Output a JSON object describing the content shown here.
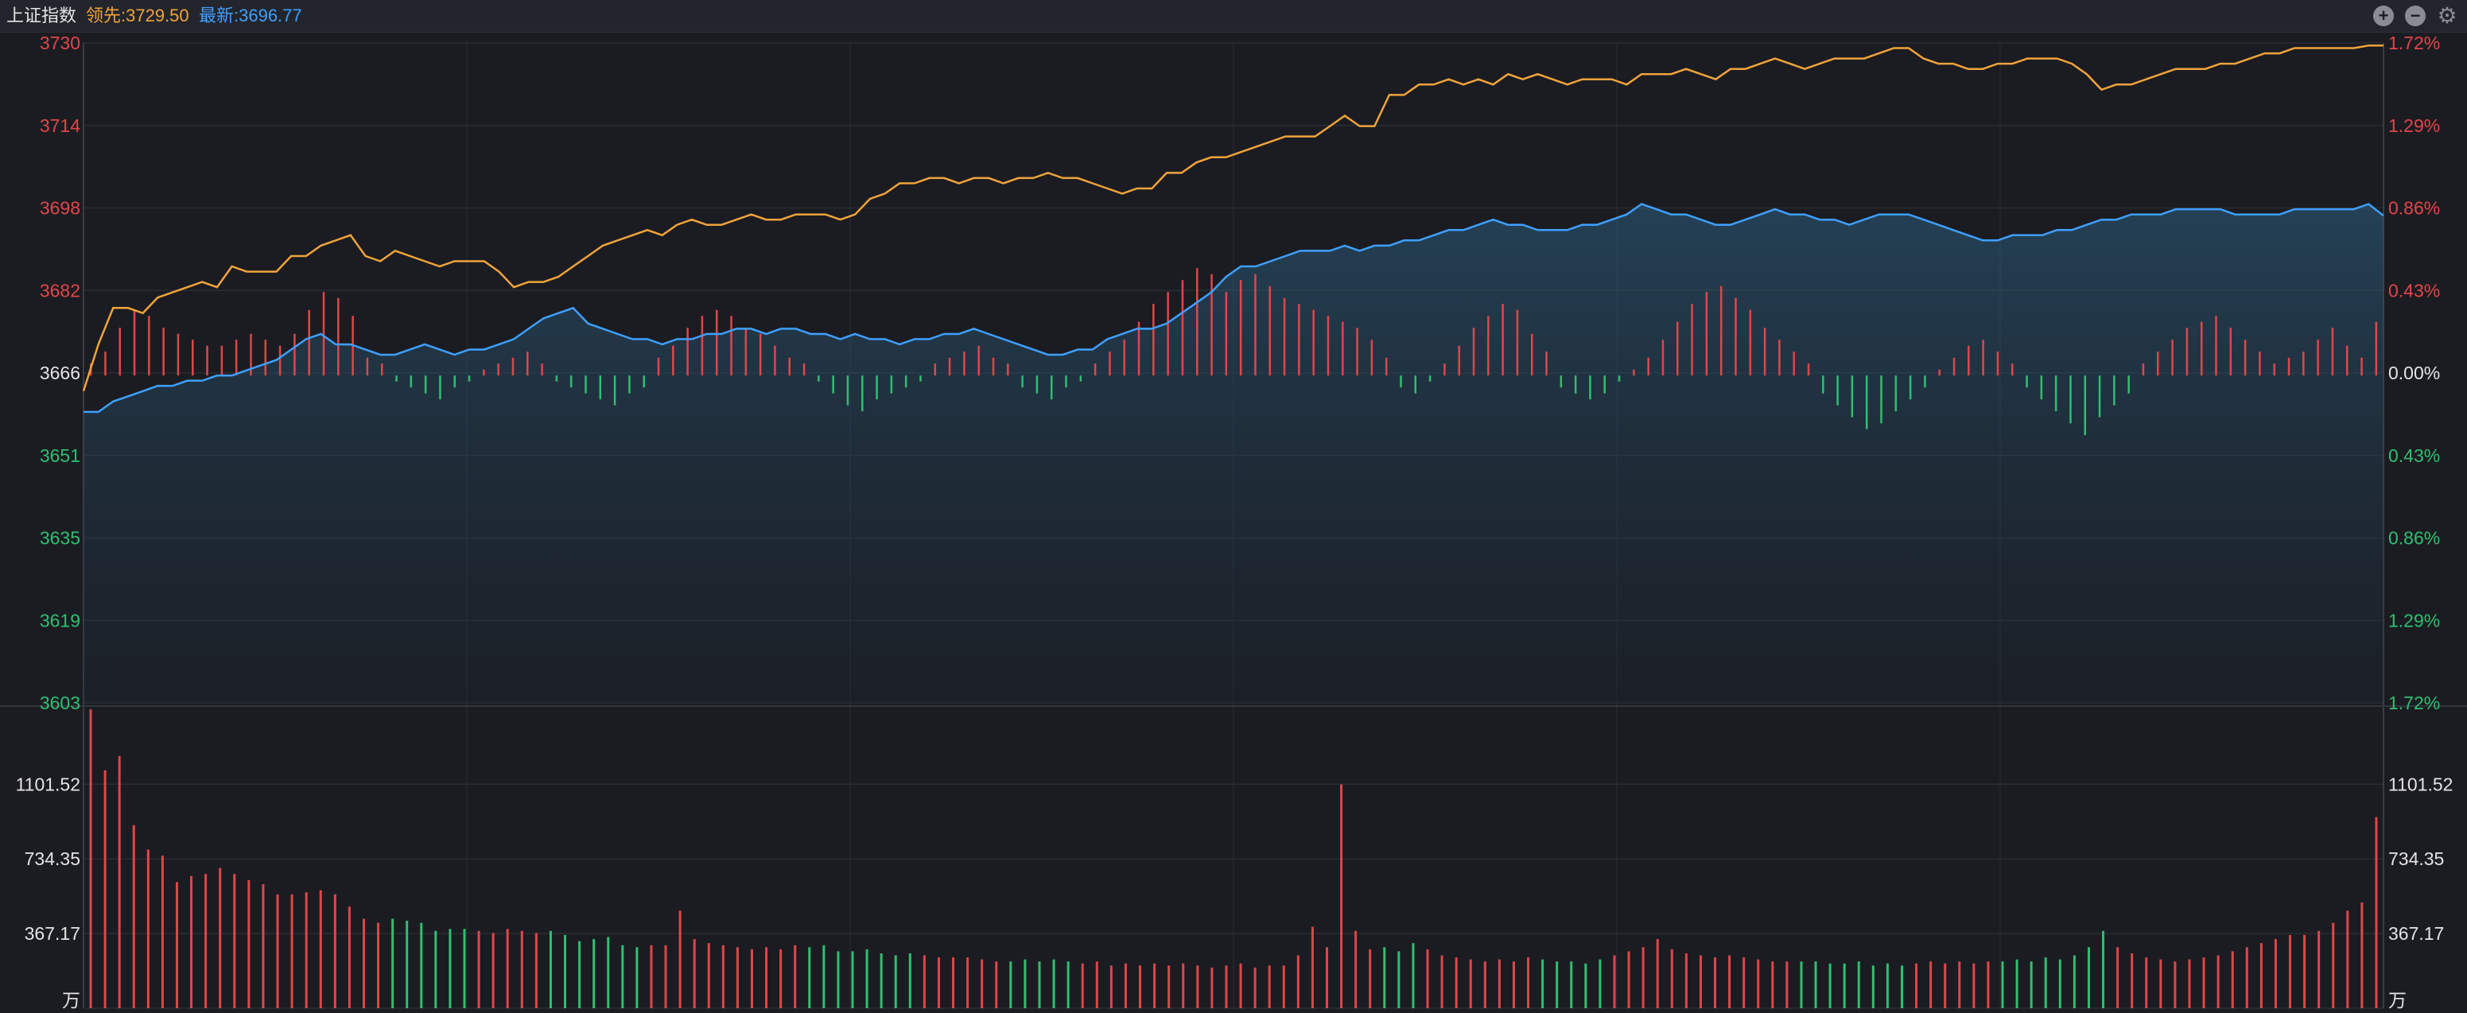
{
  "header": {
    "title": "上证指数",
    "leading": "领先:3729.50",
    "latest": "最新:3696.77"
  },
  "colors": {
    "background": "#1b1c21",
    "leading_line": "#f0a33b",
    "latest_line": "#3ea0ff",
    "up": "#e0464a",
    "down": "#2fbf71",
    "grid": "#2a2c33"
  },
  "icons": [
    "zoom-in-icon",
    "zoom-out-icon",
    "gear-icon"
  ],
  "chart_data": {
    "type": "line",
    "title": "上证指数",
    "price_axis": {
      "labels": [
        "3730",
        "3714",
        "3698",
        "3682",
        "3666",
        "3651",
        "3635",
        "3619",
        "3603"
      ],
      "range": [
        3603,
        3730
      ],
      "base": 3666
    },
    "pct_axis": {
      "labels": [
        "1.72%",
        "1.29%",
        "0.86%",
        "0.43%",
        "0.00%",
        "0.43%",
        "0.86%",
        "1.29%",
        "1.72%"
      ]
    },
    "volume_axis": {
      "labels": [
        "1101.52",
        "734.35",
        "367.17",
        "万"
      ],
      "range": [
        0,
        1470
      ]
    },
    "series": [
      {
        "name": "领先",
        "values": [
          3663,
          3672,
          3679,
          3679,
          3678,
          3681,
          3682,
          3683,
          3684,
          3683,
          3687,
          3686,
          3686,
          3686,
          3689,
          3689,
          3691,
          3692,
          3693,
          3689,
          3688,
          3690,
          3689,
          3688,
          3687,
          3688,
          3688,
          3688,
          3686,
          3683,
          3684,
          3684,
          3685,
          3687,
          3689,
          3691,
          3692,
          3693,
          3694,
          3693,
          3695,
          3696,
          3695,
          3695,
          3696,
          3697,
          3696,
          3696,
          3697,
          3697,
          3697,
          3696,
          3697,
          3700,
          3701,
          3703,
          3703,
          3704,
          3704,
          3703,
          3704,
          3704,
          3703,
          3704,
          3704,
          3705,
          3704,
          3704,
          3703,
          3702,
          3701,
          3702,
          3702,
          3705,
          3705,
          3707,
          3708,
          3708,
          3709,
          3710,
          3711,
          3712,
          3712,
          3712,
          3714,
          3716,
          3714,
          3714,
          3720,
          3720,
          3722,
          3722,
          3723,
          3722,
          3723,
          3722,
          3724,
          3723,
          3724,
          3723,
          3722,
          3723,
          3723,
          3723,
          3722,
          3724,
          3724,
          3724,
          3725,
          3724,
          3723,
          3725,
          3725,
          3726,
          3727,
          3726,
          3725,
          3726,
          3727,
          3727,
          3727,
          3728,
          3729,
          3729,
          3727,
          3726,
          3726,
          3725,
          3725,
          3726,
          3726,
          3727,
          3727,
          3727,
          3726,
          3724,
          3721,
          3722,
          3722,
          3723,
          3724,
          3725,
          3725,
          3725,
          3726,
          3726,
          3727,
          3728,
          3728,
          3729,
          3729,
          3729,
          3729,
          3729,
          3729.5,
          3729.5
        ],
        "color": "#f0a33b"
      },
      {
        "name": "最新",
        "values": [
          3659,
          3659,
          3661,
          3662,
          3663,
          3664,
          3664,
          3665,
          3665,
          3666,
          3666,
          3667,
          3668,
          3669,
          3671,
          3673,
          3674,
          3672,
          3672,
          3671,
          3670,
          3670,
          3671,
          3672,
          3671,
          3670,
          3671,
          3671,
          3672,
          3673,
          3675,
          3677,
          3678,
          3679,
          3676,
          3675,
          3674,
          3673,
          3673,
          3672,
          3673,
          3673,
          3674,
          3674,
          3675,
          3675,
          3674,
          3675,
          3675,
          3674,
          3674,
          3673,
          3674,
          3673,
          3673,
          3672,
          3673,
          3673,
          3674,
          3674,
          3675,
          3674,
          3673,
          3672,
          3671,
          3670,
          3670,
          3671,
          3671,
          3673,
          3674,
          3675,
          3675,
          3676,
          3678,
          3680,
          3682,
          3685,
          3687,
          3687,
          3688,
          3689,
          3690,
          3690,
          3690,
          3691,
          3690,
          3691,
          3691,
          3692,
          3692,
          3693,
          3694,
          3694,
          3695,
          3696,
          3695,
          3695,
          3694,
          3694,
          3694,
          3695,
          3695,
          3696,
          3697,
          3699,
          3698,
          3697,
          3697,
          3696,
          3695,
          3695,
          3696,
          3697,
          3698,
          3697,
          3697,
          3696,
          3696,
          3695,
          3696,
          3697,
          3697,
          3697,
          3696,
          3695,
          3694,
          3693,
          3692,
          3692,
          3693,
          3693,
          3693,
          3694,
          3694,
          3695,
          3696,
          3696,
          3697,
          3697,
          3697,
          3698,
          3698,
          3698,
          3698,
          3697,
          3697,
          3697,
          3697,
          3698,
          3698,
          3698,
          3698,
          3698,
          3699,
          3696.77
        ],
        "color": "#3ea0ff"
      },
      {
        "name": "涨跌柱",
        "values": [
          2,
          4,
          8,
          11,
          10,
          8,
          7,
          6,
          5,
          5,
          6,
          7,
          6,
          5,
          7,
          11,
          14,
          13,
          10,
          3,
          2,
          -1,
          -2,
          -3,
          -4,
          -2,
          -1,
          1,
          2,
          3,
          4,
          2,
          -1,
          -2,
          -3,
          -4,
          -5,
          -3,
          -2,
          3,
          5,
          8,
          10,
          11,
          10,
          8,
          7,
          5,
          3,
          2,
          -1,
          -3,
          -5,
          -6,
          -4,
          -3,
          -2,
          -1,
          2,
          3,
          4,
          5,
          3,
          2,
          -2,
          -3,
          -4,
          -2,
          -1,
          2,
          4,
          6,
          9,
          12,
          14,
          16,
          18,
          17,
          14,
          16,
          17,
          15,
          13,
          12,
          11,
          10,
          9,
          8,
          6,
          3,
          -2,
          -3,
          -1,
          2,
          5,
          8,
          10,
          12,
          11,
          7,
          4,
          -2,
          -3,
          -4,
          -3,
          -1,
          1,
          3,
          6,
          9,
          12,
          14,
          15,
          13,
          11,
          8,
          6,
          4,
          2,
          -3,
          -5,
          -7,
          -9,
          -8,
          -6,
          -4,
          -2,
          1,
          3,
          5,
          6,
          4,
          2,
          -2,
          -4,
          -6,
          -8,
          -10,
          -7,
          -5,
          -3,
          2,
          4,
          6,
          8,
          9,
          10,
          8,
          6,
          4,
          2,
          3,
          4,
          6,
          8,
          5,
          3,
          9
        ],
        "up_color": "#e0464a",
        "down_color": "#2fbf71"
      },
      {
        "name": "成交量",
        "values": [
          1470,
          1170,
          1240,
          900,
          780,
          750,
          620,
          650,
          660,
          690,
          660,
          630,
          610,
          560,
          560,
          570,
          580,
          560,
          500,
          440,
          420,
          440,
          430,
          420,
          380,
          390,
          390,
          380,
          370,
          390,
          380,
          370,
          380,
          360,
          330,
          340,
          350,
          310,
          300,
          310,
          310,
          480,
          340,
          320,
          310,
          300,
          290,
          300,
          290,
          310,
          300,
          310,
          280,
          280,
          290,
          270,
          260,
          270,
          260,
          250,
          250,
          250,
          240,
          230,
          230,
          240,
          230,
          240,
          230,
          220,
          230,
          210,
          220,
          210,
          220,
          210,
          220,
          210,
          200,
          210,
          220,
          200,
          210,
          210,
          260,
          400,
          300,
          1100,
          380,
          290,
          300,
          280,
          320,
          290,
          260,
          250,
          240,
          230,
          240,
          230,
          250,
          240,
          230,
          230,
          220,
          240,
          260,
          280,
          300,
          340,
          290,
          270,
          260,
          250,
          260,
          250,
          240,
          230,
          230,
          230,
          230,
          220,
          220,
          230,
          210,
          220,
          210,
          220,
          230,
          220,
          230,
          220,
          230,
          230,
          240,
          230,
          250,
          240,
          260,
          300,
          380,
          300,
          270,
          250,
          240,
          230,
          240,
          250,
          260,
          280,
          300,
          320,
          340,
          360,
          360,
          380,
          420,
          480,
          520,
          940
        ],
        "up_color": "#e0464a",
        "down_color": "#2fbf71"
      }
    ]
  }
}
